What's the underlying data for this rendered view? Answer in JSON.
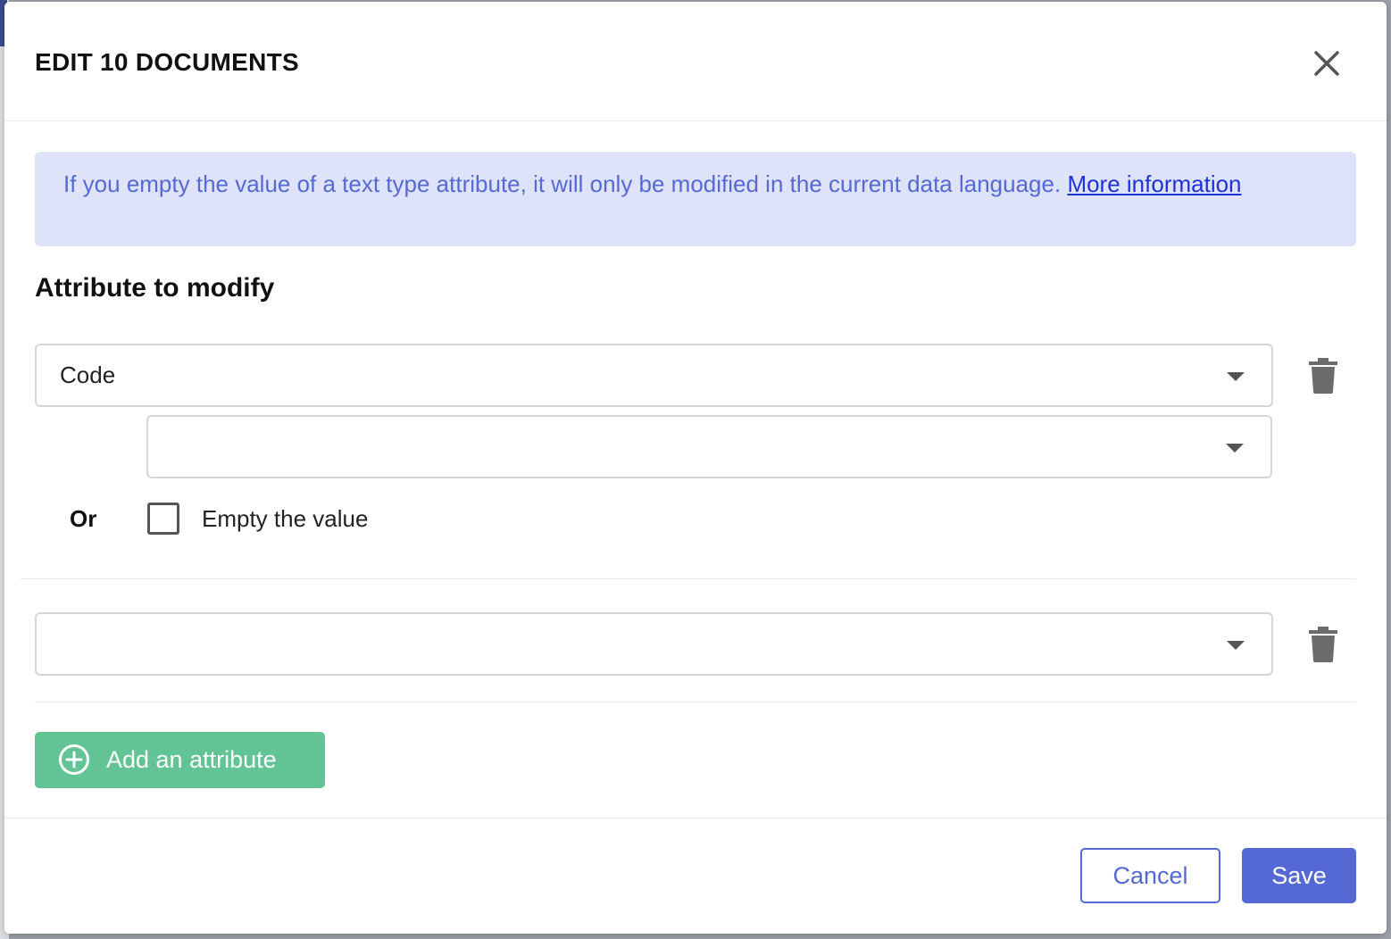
{
  "colors": {
    "primary": "#5469d4",
    "info_bg": "#dfe3fa",
    "link": "#1d32d8",
    "success": "#62c394"
  },
  "modal": {
    "title": "EDIT 10 DOCUMENTS",
    "close_icon": "close-icon"
  },
  "info": {
    "text": "If you empty the value of a text type attribute, it will only be modified in the current data language. ",
    "link_label": "More information"
  },
  "section": {
    "title": "Attribute to modify"
  },
  "attributes": [
    {
      "selected_attribute": "Code",
      "value": "",
      "or_label": "Or",
      "empty_label": "Empty the value",
      "empty_checked": false
    },
    {
      "selected_attribute": ""
    }
  ],
  "add_button": {
    "label": "Add an attribute",
    "icon": "plus-circle-icon"
  },
  "footer": {
    "cancel_label": "Cancel",
    "save_label": "Save"
  }
}
